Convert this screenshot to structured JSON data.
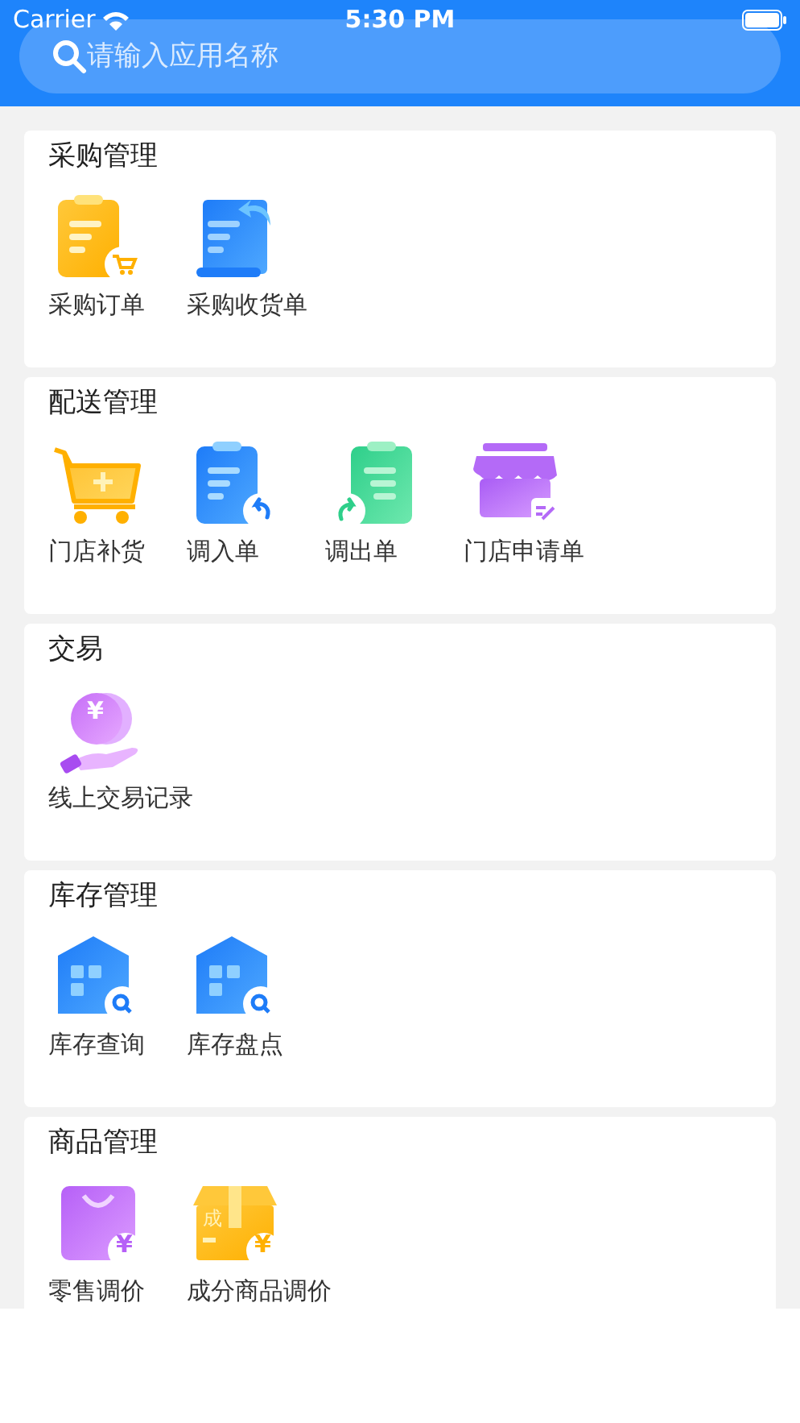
{
  "status_bar": {
    "carrier": "Carrier",
    "time": "5:30 PM"
  },
  "search": {
    "placeholder": "请输入应用名称"
  },
  "sections": [
    {
      "title": "采购管理",
      "items": [
        {
          "label": "采购订单",
          "kind": "clipboard-cart"
        },
        {
          "label": "采购收货单",
          "kind": "document-arrow"
        }
      ]
    },
    {
      "title": "配送管理",
      "items": [
        {
          "label": "门店补货",
          "kind": "cart-plus"
        },
        {
          "label": "调入单",
          "kind": "clipboard-in"
        },
        {
          "label": "调出单",
          "kind": "clipboard-out"
        },
        {
          "label": "门店申请单",
          "kind": "store-edit"
        }
      ]
    },
    {
      "title": "交易",
      "items": [
        {
          "label": "线上交易记录",
          "kind": "coin-hand",
          "glyphs": [
            "¥"
          ]
        }
      ]
    },
    {
      "title": "库存管理",
      "items": [
        {
          "label": "库存查询",
          "kind": "warehouse-search"
        },
        {
          "label": "库存盘点",
          "kind": "warehouse-search"
        }
      ]
    },
    {
      "title": "商品管理",
      "items": [
        {
          "label": "零售调价",
          "kind": "bag-yen",
          "glyphs": [
            "¥"
          ]
        },
        {
          "label": "成分商品调价",
          "kind": "box-yen",
          "glyphs": [
            "成",
            "¥"
          ]
        }
      ]
    }
  ]
}
